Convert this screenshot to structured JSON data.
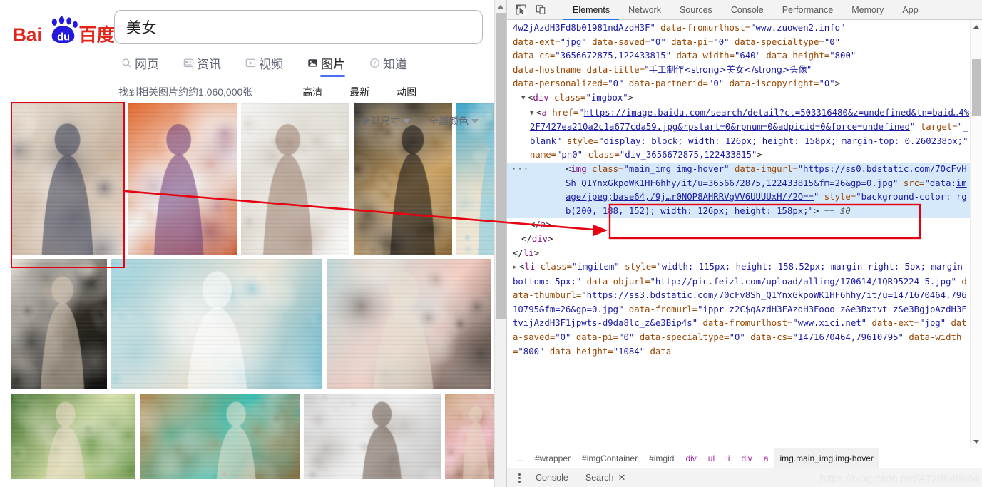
{
  "browser": {
    "logo": {
      "alt": "Baidu",
      "text_left": "Bai",
      "text_right": "百度",
      "paw_label": "du"
    },
    "search": {
      "value": "美女",
      "placeholder": ""
    },
    "tabs": [
      {
        "label": "网页",
        "icon": "search-icon",
        "active": false
      },
      {
        "label": "资讯",
        "icon": "news-icon",
        "active": false
      },
      {
        "label": "视频",
        "icon": "video-icon",
        "active": false
      },
      {
        "label": "图片",
        "icon": "image-icon",
        "active": true
      },
      {
        "label": "知道",
        "icon": "question-icon",
        "active": false
      }
    ],
    "result_count": "找到相关图片约约1,060,000张",
    "filters": [
      "高清",
      "最新",
      "动图"
    ],
    "dropdowns": [
      {
        "label": "全部尺寸"
      },
      {
        "label": "全部颜色"
      }
    ]
  },
  "devtools": {
    "toolbar_icons": [
      "inspect-element-icon",
      "device-toolbar-icon"
    ],
    "tabs": [
      {
        "label": "Elements",
        "active": true
      },
      {
        "label": "Network",
        "active": false
      },
      {
        "label": "Sources",
        "active": false
      },
      {
        "label": "Console",
        "active": false
      },
      {
        "label": "Performance",
        "active": false
      },
      {
        "label": "Memory",
        "active": false
      },
      {
        "label": "App",
        "active": false
      }
    ],
    "code_lines": [
      {
        "id": "l1",
        "hl": false,
        "indent": 0,
        "parts": [
          {
            "t": "val",
            "s": "4w2jAzdH3Fd8b01981ndAzdH3F\""
          },
          {
            "t": "sp",
            "s": " "
          },
          {
            "t": "attr",
            "s": "data-fromurlhost="
          },
          {
            "t": "val",
            "s": "\"www.zuowen2.info\""
          }
        ]
      },
      {
        "id": "l2",
        "hl": false,
        "indent": 0,
        "parts": [
          {
            "t": "attr",
            "s": "data-ext="
          },
          {
            "t": "val",
            "s": "\"jpg\""
          },
          {
            "t": "sp",
            "s": " "
          },
          {
            "t": "attr",
            "s": "data-saved="
          },
          {
            "t": "val",
            "s": "\"0\""
          },
          {
            "t": "sp",
            "s": " "
          },
          {
            "t": "attr",
            "s": "data-pi="
          },
          {
            "t": "val",
            "s": "\"0\""
          },
          {
            "t": "sp",
            "s": " "
          },
          {
            "t": "attr",
            "s": "data-specialtype="
          },
          {
            "t": "val",
            "s": "\"0\""
          }
        ]
      },
      {
        "id": "l3",
        "hl": false,
        "indent": 0,
        "parts": [
          {
            "t": "attr",
            "s": "data-cs="
          },
          {
            "t": "val",
            "s": "\"3656672875,122433815\""
          },
          {
            "t": "sp",
            "s": " "
          },
          {
            "t": "attr",
            "s": "data-width="
          },
          {
            "t": "val",
            "s": "\"640\""
          },
          {
            "t": "sp",
            "s": " "
          },
          {
            "t": "attr",
            "s": "data-height="
          },
          {
            "t": "val",
            "s": "\"800\""
          }
        ]
      },
      {
        "id": "l4",
        "hl": false,
        "indent": 0,
        "parts": [
          {
            "t": "attr",
            "s": "data-hostname"
          },
          {
            "t": "sp",
            "s": " "
          },
          {
            "t": "attr",
            "s": "data-title="
          },
          {
            "t": "cjk",
            "s": "\"手工制作<strong>美女</strong>头像\""
          }
        ]
      },
      {
        "id": "l5",
        "hl": false,
        "indent": 0,
        "parts": [
          {
            "t": "attr",
            "s": "data-personalized="
          },
          {
            "t": "val",
            "s": "\"0\""
          },
          {
            "t": "sp",
            "s": " "
          },
          {
            "t": "attr",
            "s": "data-partnerid="
          },
          {
            "t": "val",
            "s": "\"0\""
          },
          {
            "t": "sp",
            "s": " "
          },
          {
            "t": "attr",
            "s": "data-iscopyright="
          },
          {
            "t": "val",
            "s": "\"0\""
          },
          {
            "t": "punc",
            "s": ">"
          }
        ]
      },
      {
        "id": "l6",
        "hl": false,
        "indent": 1,
        "tri": "▼",
        "parts": [
          {
            "t": "punc",
            "s": "<"
          },
          {
            "t": "tag",
            "s": "div"
          },
          {
            "t": "sp",
            "s": " "
          },
          {
            "t": "attr",
            "s": "class="
          },
          {
            "t": "val",
            "s": "\"imgbox\""
          },
          {
            "t": "punc",
            "s": ">"
          }
        ]
      },
      {
        "id": "l7",
        "hl": false,
        "indent": 2,
        "tri": "▼",
        "parts": [
          {
            "t": "punc",
            "s": "<"
          },
          {
            "t": "tag",
            "s": "a"
          },
          {
            "t": "sp",
            "s": " "
          },
          {
            "t": "attr",
            "s": "href="
          },
          {
            "t": "val",
            "s": "\""
          },
          {
            "t": "lnk",
            "s": "https://image.baidu.com/search/detail?ct=503316480&z=undefined&tn=baid…4%2F7427ea210a2c1a677cda59.jpg&rpstart=0&rpnum=0&adpicid=0&force=undefined"
          },
          {
            "t": "val",
            "s": "\""
          },
          {
            "t": "sp",
            "s": " "
          },
          {
            "t": "attr",
            "s": "target="
          },
          {
            "t": "val",
            "s": "\"_blank\""
          },
          {
            "t": "sp",
            "s": " "
          },
          {
            "t": "attr",
            "s": "style="
          },
          {
            "t": "val",
            "s": "\"display: block; width: 126px; height: 158px; margin-top: 0.260238px;\""
          },
          {
            "t": "sp",
            "s": " "
          },
          {
            "t": "attr",
            "s": "name="
          },
          {
            "t": "val",
            "s": "\"pn0\""
          },
          {
            "t": "sp",
            "s": " "
          },
          {
            "t": "attr",
            "s": "class="
          },
          {
            "t": "val",
            "s": "\"div_3656672875,122433815\""
          },
          {
            "t": "punc",
            "s": ">"
          }
        ]
      },
      {
        "id": "l8",
        "hl": true,
        "indent": 3,
        "dots": "···",
        "parts": [
          {
            "t": "punc",
            "s": "<"
          },
          {
            "t": "tag",
            "s": "img"
          },
          {
            "t": "sp",
            "s": " "
          },
          {
            "t": "attr",
            "s": "class="
          },
          {
            "t": "val",
            "s": "\"main_img img-hover\""
          },
          {
            "t": "sp",
            "s": " "
          },
          {
            "t": "attr",
            "s": "data-imgurl="
          },
          {
            "t": "val",
            "s": "\"https://ss0.bdstatic.com/70cFvHSh_Q1YnxGkpoWK1HF6hhy/it/u=3656672875,122433815&fm=26&gp=0.jpg\""
          },
          {
            "t": "sp",
            "s": " "
          },
          {
            "t": "attr",
            "s": "src="
          },
          {
            "t": "val",
            "s": "\"data:"
          },
          {
            "t": "lnk",
            "s": "image/jpeg;base64,/9j…r0NOP8AHRRVgVV6UUUUxH//2Q=="
          },
          {
            "t": "val",
            "s": "\""
          },
          {
            "t": "sp",
            "s": " "
          },
          {
            "t": "attr",
            "s": "style="
          },
          {
            "t": "val",
            "s": "\"background-color: rgb(200, 188, 152); width: 126px; height: 158px;\""
          },
          {
            "t": "punc",
            "s": "> == "
          },
          {
            "t": "dollar",
            "s": "$0"
          }
        ]
      },
      {
        "id": "l9",
        "hl": false,
        "indent": 2,
        "parts": [
          {
            "t": "punc",
            "s": "</"
          },
          {
            "t": "tag",
            "s": "a"
          },
          {
            "t": "punc",
            "s": ">"
          }
        ]
      },
      {
        "id": "l10",
        "hl": false,
        "indent": 1,
        "parts": [
          {
            "t": "punc",
            "s": "</"
          },
          {
            "t": "tag",
            "s": "div"
          },
          {
            "t": "punc",
            "s": ">"
          }
        ]
      },
      {
        "id": "l11",
        "hl": false,
        "indent": 0,
        "parts": [
          {
            "t": "punc",
            "s": "</"
          },
          {
            "t": "tag",
            "s": "li"
          },
          {
            "t": "punc",
            "s": ">"
          }
        ]
      },
      {
        "id": "l12",
        "hl": false,
        "indent": 0,
        "tri": "▶",
        "parts": [
          {
            "t": "punc",
            "s": "<"
          },
          {
            "t": "tag",
            "s": "li"
          },
          {
            "t": "sp",
            "s": " "
          },
          {
            "t": "attr",
            "s": "class="
          },
          {
            "t": "val",
            "s": "\"imgitem\""
          },
          {
            "t": "sp",
            "s": " "
          },
          {
            "t": "attr",
            "s": "style="
          },
          {
            "t": "val",
            "s": "\"width: 115px; height: 158.52px; margin-right: 5px; margin-bottom: 5px;\""
          },
          {
            "t": "sp",
            "s": " "
          },
          {
            "t": "attr",
            "s": "data-objurl="
          },
          {
            "t": "val",
            "s": "\"http://pic.feizl.com/upload/allimg/170614/1QR95224-5.jpg\""
          },
          {
            "t": "sp",
            "s": " "
          },
          {
            "t": "attr",
            "s": "data-thumburl="
          },
          {
            "t": "val",
            "s": "\"https://ss3.bdstatic.com/70cFv8Sh_Q1YnxGkpoWK1HF6hhy/it/u=1471670464,79610795&fm=26&gp=0.jpg\""
          },
          {
            "t": "sp",
            "s": " "
          },
          {
            "t": "attr",
            "s": "data-fromurl="
          },
          {
            "t": "val",
            "s": "\"ippr_z2C$qAzdH3FAzdH3Fooo_z&e3Bxtvt_z&e3BgjpAzdH3FtvijAzdH3F1jpwts-d9da8lc_z&e3Bip4s\""
          },
          {
            "t": "sp",
            "s": " "
          },
          {
            "t": "attr",
            "s": "data-fromurlhost="
          },
          {
            "t": "val",
            "s": "\"www.xici.net\""
          },
          {
            "t": "sp",
            "s": " "
          },
          {
            "t": "attr",
            "s": "data-ext="
          },
          {
            "t": "val",
            "s": "\"jpg\""
          },
          {
            "t": "sp",
            "s": " "
          },
          {
            "t": "attr",
            "s": "data-saved="
          },
          {
            "t": "val",
            "s": "\"0\""
          },
          {
            "t": "sp",
            "s": " "
          },
          {
            "t": "attr",
            "s": "data-pi="
          },
          {
            "t": "val",
            "s": "\"0\""
          },
          {
            "t": "sp",
            "s": " "
          },
          {
            "t": "attr",
            "s": "data-specialtype="
          },
          {
            "t": "val",
            "s": "\"0\""
          },
          {
            "t": "sp",
            "s": " "
          },
          {
            "t": "attr",
            "s": "data-cs="
          },
          {
            "t": "val",
            "s": "\"1471670464,79610795\""
          },
          {
            "t": "sp",
            "s": " "
          },
          {
            "t": "attr",
            "s": "data-width="
          },
          {
            "t": "val",
            "s": "\"800\""
          },
          {
            "t": "sp",
            "s": " "
          },
          {
            "t": "attr",
            "s": "data-height="
          },
          {
            "t": "val",
            "s": "\"1084\""
          },
          {
            "t": "sp",
            "s": " "
          },
          {
            "t": "attr",
            "s": "data-"
          }
        ]
      }
    ],
    "breadcrumb": [
      "…",
      "#wrapper",
      "#imgContainer",
      "#imgid",
      "div",
      "ul",
      "li",
      "div",
      "a",
      "img.main_img.img-hover"
    ],
    "breadcrumb_tagnames": [
      "div",
      "ul",
      "li",
      "div",
      "a"
    ],
    "breadcrumb_selected": "img.main_img.img-hover",
    "drawer": {
      "tabs": [
        "Console",
        "Search"
      ],
      "close_label": "✕"
    }
  },
  "watermark": "https://blog.csdn.net/A728848944",
  "colors": {
    "accent": "#4e6ef2",
    "devtools_accent": "#1a73e8",
    "annotation_red": "#e60012",
    "highlight_blue": "#d6e9fb",
    "baidu_red": "#e1251b",
    "baidu_blue": "#2319dc"
  },
  "annotations": {
    "selection_box_label": "selected-thumbnail-highlight",
    "callout_box_label": "img-url-highlight",
    "arrow_label": "pointer-arrow"
  }
}
